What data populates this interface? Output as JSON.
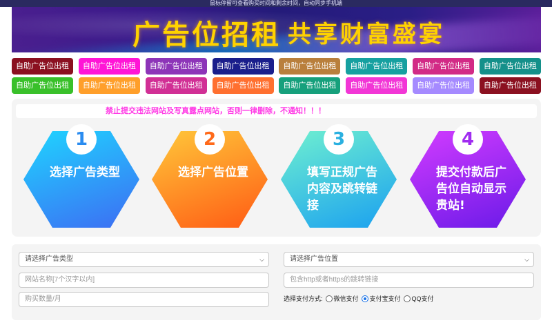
{
  "top_notice": "鼠标停留可查看购买时间和剩余时间，自动同步手机端",
  "banner": {
    "title": "广告位招租",
    "subtitle": "共享财富盛宴"
  },
  "ad_slots": {
    "label": "自助广告位出租",
    "row1_colors": [
      "#8b1020",
      "#ff15d6",
      "#8d34b8",
      "#1a1e8c",
      "#b97f3c",
      "#16a0a0",
      "#d22a86",
      "#14908a"
    ],
    "row2_colors": [
      "#39c02a",
      "#ff9f2a",
      "#d12f95",
      "#ff7030",
      "#16a07c",
      "#f236d6",
      "#a58aff",
      "#8b1020"
    ]
  },
  "warning": "禁止提交违法网站及写真露点网站，否则一律删除，不通知！！！",
  "steps": [
    {
      "number": "1",
      "label": "选择广告类型",
      "from": "#1fd5ff",
      "to": "#3d6cf3",
      "num_color": "#2a8cf0"
    },
    {
      "number": "2",
      "label": "选择广告位置",
      "from": "#ffc83a",
      "to": "#ff5a14",
      "num_color": "#ff6a1a"
    },
    {
      "number": "3",
      "label": "填写正规广告内容及跳转链接",
      "from": "#6ff0d0",
      "to": "#1aa0f0",
      "num_color": "#2ab0e0"
    },
    {
      "number": "4",
      "label": "提交付款后广告位自动显示贵站!",
      "from": "#d23cff",
      "to": "#6a1ae8",
      "num_color": "#a02cf0"
    }
  ],
  "form": {
    "ad_type_select": "请选择广告类型",
    "ad_position_select": "请选择广告位置",
    "site_name_placeholder": "网站名称[7个汉字以内]",
    "link_placeholder": "包含http或者https的跳转链接",
    "quantity_placeholder": "购买数量/月",
    "pay_label": "选择支付方式:",
    "pay_options": [
      "微信支付",
      "支付宝支付",
      "QQ支付"
    ],
    "pay_selected_index": 1
  }
}
